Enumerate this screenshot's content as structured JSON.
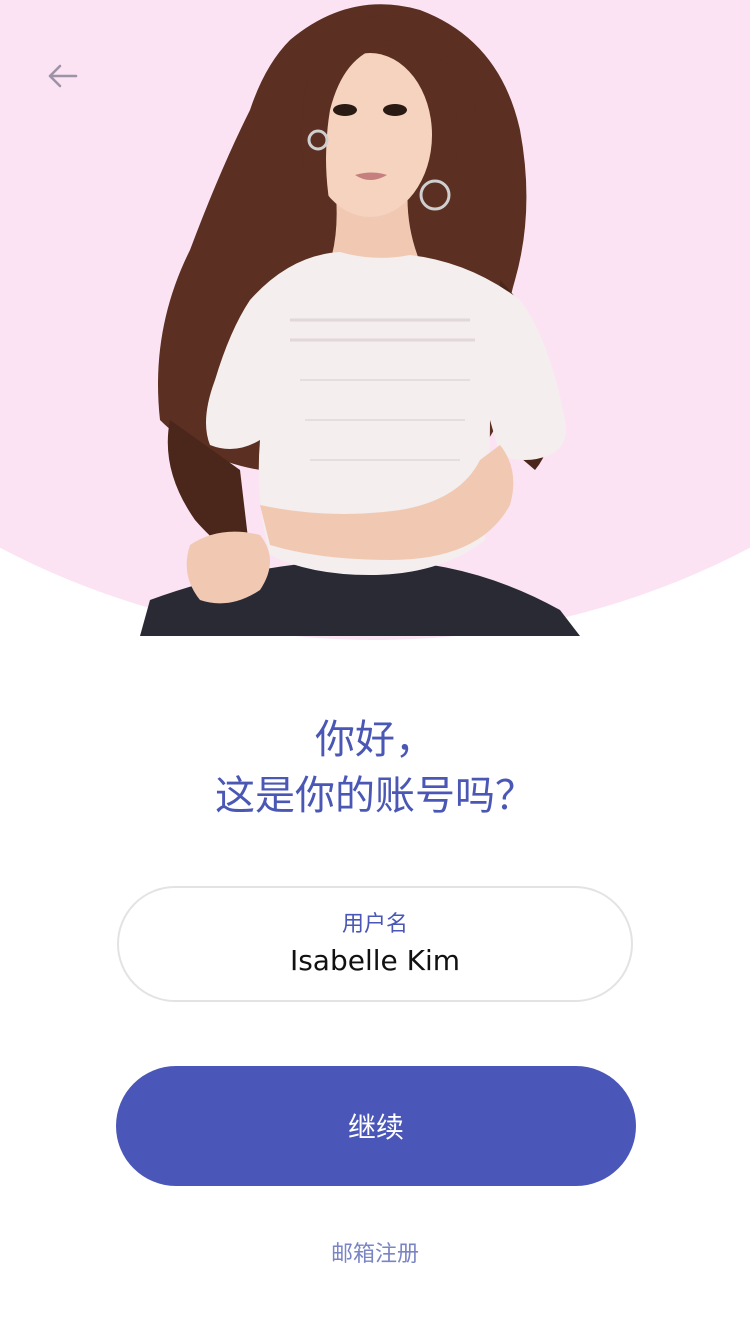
{
  "header": {
    "back_icon": "arrow-left-icon"
  },
  "hero": {
    "background_color": "#fbe3f3",
    "image": "woman-portrait-photo"
  },
  "greeting": {
    "line1": "你好，",
    "line2": "这是你的账号吗？"
  },
  "username_field": {
    "label": "用户名",
    "value": "Isabelle Kim"
  },
  "continue_button": {
    "label": "继续"
  },
  "signup_link": {
    "label": "邮箱注册"
  },
  "colors": {
    "primary": "#4a57b8",
    "hero_bg": "#fbe3f3",
    "text_dark": "#111111",
    "link": "#7a85c4"
  }
}
